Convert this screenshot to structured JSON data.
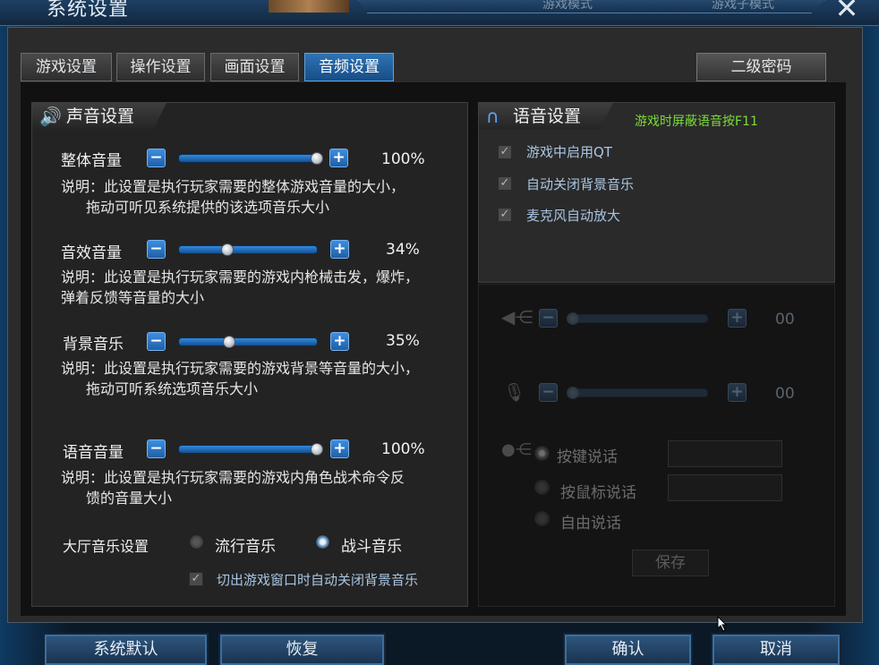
{
  "window": {
    "title": "系统设置",
    "mode_a": "游戏模式",
    "mode_b": "游戏子模式",
    "close": "✕"
  },
  "tabs": [
    {
      "label": "游戏设置"
    },
    {
      "label": "操作设置"
    },
    {
      "label": "画面设置"
    },
    {
      "label": "音频设置",
      "active": true
    }
  ],
  "secondary_password": "二级密码",
  "sound": {
    "header": "声音设置",
    "rows": [
      {
        "label": "整体音量",
        "value": 100,
        "value_text": "100%",
        "desc1": "说明：此设置是执行玩家需要的整体游戏音量的大小，",
        "desc2": "拖动可听见系统提供的该选项音乐大小"
      },
      {
        "label": "音效音量",
        "value": 34,
        "value_text": "34%",
        "desc1": "说明：此设置是执行玩家需要的游戏内枪械击发，爆炸，",
        "desc2": "弹着反馈等音量的大小"
      },
      {
        "label": "背景音乐",
        "value": 35,
        "value_text": "35%",
        "desc1": "说明：此设置是执行玩家需要的游戏背景等音量的大小，",
        "desc2": "拖动可听系统选项音乐大小"
      },
      {
        "label": "语音音量",
        "value": 100,
        "value_text": "100%",
        "desc1": "说明：此设置是执行玩家需要的游戏内角色战术命令反",
        "desc2": "馈的音量大小"
      }
    ],
    "lobby_music_label": "大厅音乐设置",
    "lobby_options": [
      {
        "label": "流行音乐",
        "selected": false
      },
      {
        "label": "战斗音乐",
        "selected": true
      }
    ],
    "auto_close_bgm": "切出游戏窗口时自动关闭背景音乐"
  },
  "voice": {
    "header": "语音设置",
    "hint": "游戏时屏蔽语音按F11",
    "checks": [
      {
        "label": "游戏中启用QT"
      },
      {
        "label": "自动关闭背景音乐"
      },
      {
        "label": "麦克风自动放大"
      }
    ],
    "speaker_value": 0,
    "speaker_value_text": "00",
    "mic_value": 0,
    "mic_value_text": "00",
    "talk_modes": [
      {
        "label": "按键说话",
        "selected": true
      },
      {
        "label": "按鼠标说话",
        "selected": false
      },
      {
        "label": "自由说话",
        "selected": false
      }
    ],
    "save": "保存"
  },
  "buttons": {
    "default": "系统默认",
    "restore": "恢复",
    "confirm": "确认",
    "cancel": "取消"
  },
  "icons": {
    "speaker": "speaker-icon",
    "headset": "headset-icon",
    "mic": "microphone-icon"
  },
  "colors": {
    "accent": "#2e74b5",
    "hint": "#7cdc3a"
  }
}
